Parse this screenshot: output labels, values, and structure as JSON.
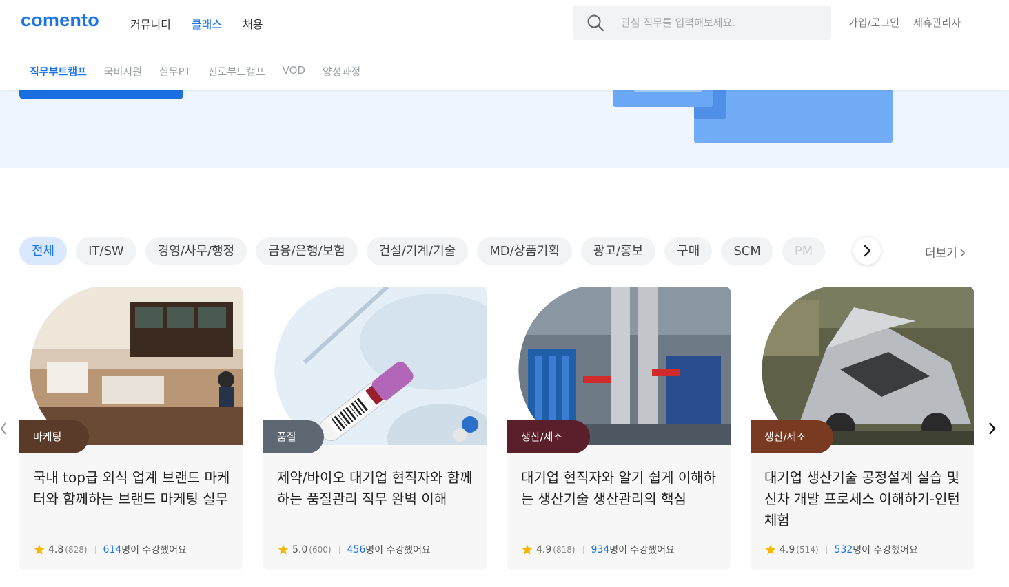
{
  "brand": {
    "logo": "comento",
    "accent": "#1a73e8"
  },
  "main_menu": [
    {
      "label": "커뮤니티",
      "active": false
    },
    {
      "label": "클래스",
      "active": true
    },
    {
      "label": "채용",
      "active": false
    }
  ],
  "search": {
    "placeholder": "관심 직무를 입력해보세요.",
    "icon": "search-icon"
  },
  "auth": {
    "login_label": "가입/로그인",
    "partner_label": "제휴관리자"
  },
  "sub_menu": [
    {
      "label": "직무부트캠프",
      "active": true
    },
    {
      "label": "국비지원",
      "active": false
    },
    {
      "label": "실무PT",
      "active": false
    },
    {
      "label": "진로부트캠프",
      "active": false
    },
    {
      "label": "VOD",
      "active": false
    },
    {
      "label": "양성과정",
      "active": false
    }
  ],
  "categories": [
    {
      "label": "전체",
      "active": true
    },
    {
      "label": "IT/SW"
    },
    {
      "label": "경영/사무/행정"
    },
    {
      "label": "금융/은행/보험"
    },
    {
      "label": "건설/기계/기술"
    },
    {
      "label": "MD/상품기획"
    },
    {
      "label": "광고/홍보"
    },
    {
      "label": "구매"
    },
    {
      "label": "SCM"
    },
    {
      "label": "PM"
    }
  ],
  "more_label": "더보기",
  "cards": [
    {
      "badge": "마케팅",
      "badge_color": "#5a3a28",
      "title": "국내 top급 외식 업계 브랜드 마케터와 함께하는 브랜드 마케팅 실무",
      "rating": "4.8",
      "reviews": "(828)",
      "students": "614",
      "students_label": "명이 수강했어요"
    },
    {
      "badge": "품질",
      "badge_color": "#5e6873",
      "title": "제약/바이오 대기업 현직자와 함께하는 품질관리 직무 완벽 이해",
      "rating": "5.0",
      "reviews": "(600)",
      "students": "456",
      "students_label": "명이 수강했어요"
    },
    {
      "badge": "생산/제조",
      "badge_color": "#5b1f2b",
      "title": "대기업 현직자와 알기 쉽게 이해하는 생산기술 생산관리의 핵심",
      "rating": "4.9",
      "reviews": "(818)",
      "students": "934",
      "students_label": "명이 수강했어요"
    },
    {
      "badge": "생산/제조",
      "badge_color": "#7a3a22",
      "title": "대기업 생산기술 공정설계 실습 및 신차 개발 프로세스 이해하기-인턴체험",
      "rating": "4.9",
      "reviews": "(514)",
      "students": "532",
      "students_label": "명이 수강했어요"
    }
  ]
}
